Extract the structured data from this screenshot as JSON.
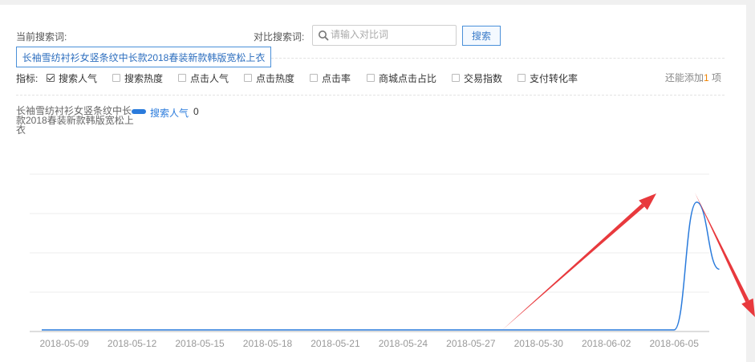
{
  "current_term_label": "当前搜索词:",
  "current_term": "长袖雪纺衬衫女竖条纹中长款2018春装新款韩版宽松上衣",
  "compare_label": "对比搜索词:",
  "compare_input": {
    "value": "",
    "placeholder": "请输入对比词"
  },
  "search_button": "搜索",
  "metrics_label": "指标:",
  "metrics": [
    {
      "label": "搜索人气",
      "checked": true
    },
    {
      "label": "搜索热度",
      "checked": false
    },
    {
      "label": "点击人气",
      "checked": false
    },
    {
      "label": "点击热度",
      "checked": false
    },
    {
      "label": "点击率",
      "checked": false
    },
    {
      "label": "商城点击占比",
      "checked": false
    },
    {
      "label": "交易指数",
      "checked": false
    },
    {
      "label": "支付转化率",
      "checked": false
    }
  ],
  "remaining": {
    "prefix": "还能添加",
    "count": "1",
    "suffix": "项"
  },
  "legend": {
    "term": "长袖雪纺衬衫女竖条纹中长款2018春装新款韩版宽松上衣",
    "series_name": "搜索人气",
    "value": "0"
  },
  "colors": {
    "accent": "#2a7bdc",
    "annotation_arrow": "#e8393d",
    "remaining_count": "#f08300"
  },
  "chart_data": {
    "type": "line",
    "x": [
      "2018-05-08",
      "2018-05-09",
      "2018-05-10",
      "2018-05-11",
      "2018-05-12",
      "2018-05-13",
      "2018-05-14",
      "2018-05-15",
      "2018-05-16",
      "2018-05-17",
      "2018-05-18",
      "2018-05-19",
      "2018-05-20",
      "2018-05-21",
      "2018-05-22",
      "2018-05-23",
      "2018-05-24",
      "2018-05-25",
      "2018-05-26",
      "2018-05-27",
      "2018-05-28",
      "2018-05-29",
      "2018-05-30",
      "2018-05-31",
      "2018-06-01",
      "2018-06-02",
      "2018-06-03",
      "2018-06-04",
      "2018-06-05",
      "2018-06-06",
      "2018-06-07"
    ],
    "x_ticks": [
      "2018-05-09",
      "2018-05-12",
      "2018-05-15",
      "2018-05-18",
      "2018-05-21",
      "2018-05-24",
      "2018-05-27",
      "2018-05-30",
      "2018-06-02",
      "2018-06-05"
    ],
    "series": [
      {
        "name": "搜索人气",
        "values": [
          0,
          0,
          0,
          0,
          0,
          0,
          0,
          0,
          0,
          0,
          0,
          0,
          0,
          0,
          0,
          0,
          0,
          0,
          0,
          0,
          0,
          0,
          0,
          0,
          0,
          0,
          0,
          0,
          0,
          0.82,
          0.39
        ]
      }
    ],
    "ylim": [
      0,
      1
    ],
    "grid": true,
    "title": "",
    "xlabel": "",
    "ylabel": ""
  }
}
